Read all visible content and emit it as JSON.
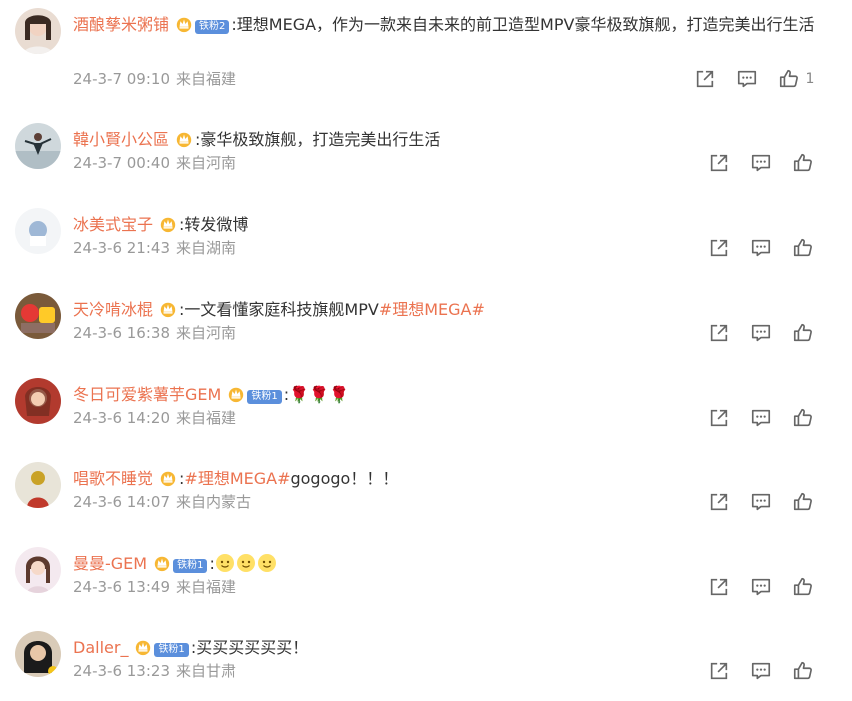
{
  "comments": [
    {
      "username": "酒酿孳米粥铺",
      "fan_badge": "铁粉2",
      "text": ":理想MEGA，作为一款来自未来的前卫造型MPV豪华极致旗舰，打造完美出行生活",
      "date": "24-3-7 09:10",
      "location": "来自福建",
      "like_count": "1"
    },
    {
      "username": "韓小賢小公區",
      "fan_badge": "",
      "text": ":豪华极致旗舰，打造完美出行生活",
      "date": "24-3-7 00:40",
      "location": "来自河南",
      "like_count": ""
    },
    {
      "username": "冰美式宝子",
      "fan_badge": "",
      "text": ":转发微博",
      "date": "24-3-6 21:43",
      "location": "来自湖南",
      "like_count": ""
    },
    {
      "username": "天冷啃冰棍",
      "fan_badge": "",
      "text_prefix": ":一文看懂家庭科技旗舰MPV",
      "hashtag": "#理想MEGA#",
      "date": "24-3-6 16:38",
      "location": "来自河南",
      "like_count": ""
    },
    {
      "username": "冬日可爱紫薯芋GEM",
      "fan_badge": "铁粉1",
      "text": ":",
      "emoji": "🌹🌹🌹",
      "date": "24-3-6 14:20",
      "location": "来自福建",
      "like_count": ""
    },
    {
      "username": "唱歌不睡觉",
      "fan_badge": "",
      "text_prefix": ":",
      "hashtag": "#理想MEGA#",
      "text_suffix": "gogogo！！！",
      "date": "24-3-6 14:07",
      "location": "来自内蒙古",
      "like_count": ""
    },
    {
      "username": "曼曼-GEM",
      "fan_badge": "铁粉1",
      "text": ":",
      "date": "24-3-6 13:49",
      "location": "来自福建",
      "like_count": ""
    },
    {
      "username": "Daller_",
      "fan_badge": "铁粉1",
      "text": ":买买买买买买！",
      "date": "24-3-6 13:23",
      "location": "来自甘肃",
      "like_count": ""
    }
  ],
  "icons": {
    "share": "share-icon",
    "comment": "comment-icon",
    "like": "thumbs-up-icon",
    "vip": "crown-icon"
  },
  "colors": {
    "username": "#eb7350",
    "meta": "#999999",
    "text": "#333333",
    "fan_badge": "#5b8fdc"
  }
}
